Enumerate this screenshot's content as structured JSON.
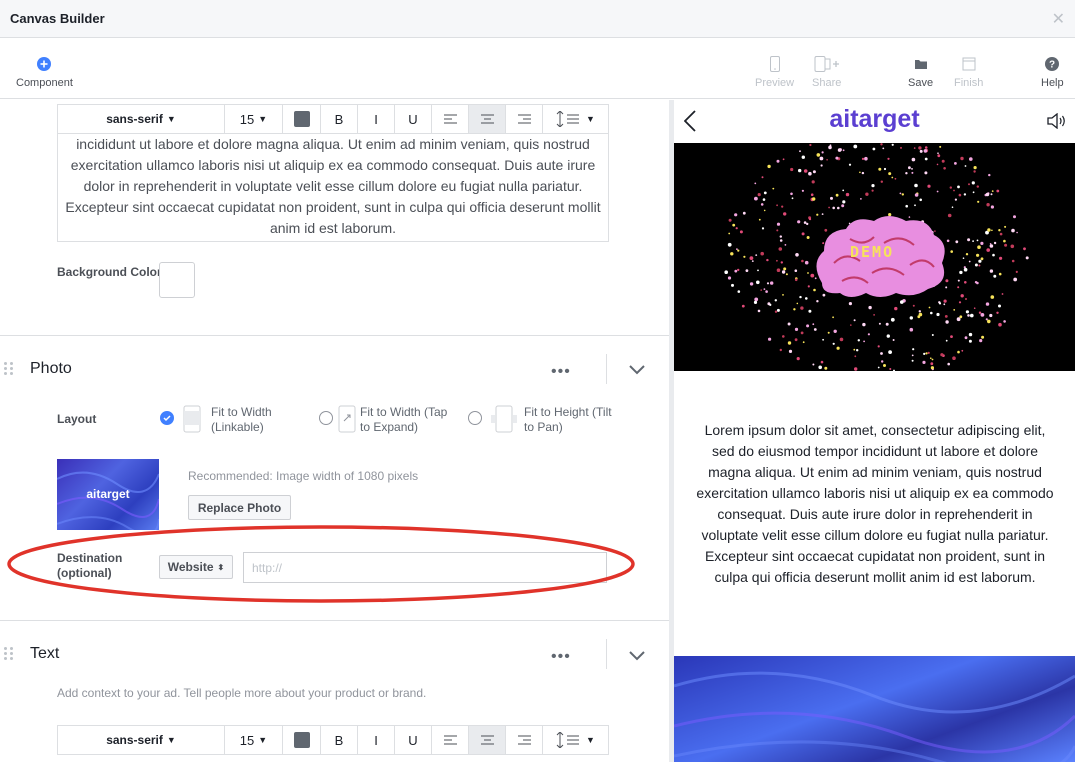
{
  "app": {
    "title": "Canvas Builder"
  },
  "toolbar": {
    "component": "Component",
    "preview": "Preview",
    "share": "Share",
    "save": "Save",
    "finish": "Finish",
    "help": "Help"
  },
  "text_editor_top": {
    "font": "sans-serif",
    "size": "15",
    "bold": "B",
    "italic": "I",
    "underline": "U",
    "body": "incididunt ut labore et dolore magna aliqua. Ut enim ad minim veniam, quis nostrud exercitation ullamco laboris nisi ut aliquip ex ea commodo consequat. Duis aute irure dolor in reprehenderit in voluptate velit esse cillum dolore eu fugiat nulla pariatur. Excepteur sint occaecat cupidatat non proident, sunt in culpa qui officia deserunt mollit anim id est laborum."
  },
  "background_color_label": "Background Color",
  "photo": {
    "title": "Photo",
    "more": "•••",
    "layout_label": "Layout",
    "options": [
      {
        "label": "Fit to Width (Linkable)",
        "selected": true
      },
      {
        "label": "Fit to Width (Tap to Expand)",
        "selected": false
      },
      {
        "label": "Fit to Height (Tilt to Pan)",
        "selected": false
      }
    ],
    "thumb_text": "aitarget",
    "recommended": "Recommended: Image width of 1080 pixels",
    "replace_button": "Replace Photo",
    "destination_label": "Destination (optional)",
    "destination_type": "Website",
    "destination_placeholder": "http://"
  },
  "text_section": {
    "title": "Text",
    "more": "•••",
    "description": "Add context to your ad. Tell people more about your product or brand.",
    "font": "sans-serif",
    "size": "15",
    "bold": "B",
    "italic": "I",
    "underline": "U"
  },
  "preview": {
    "brand": "aitarget",
    "image_text": "DEMO",
    "body": "Lorem ipsum dolor sit amet, consectetur adipiscing elit, sed do eiusmod tempor incididunt ut labore et dolore magna aliqua. Ut enim ad minim veniam, quis nostrud exercitation ullamco laboris nisi ut aliquip ex ea commodo consequat. Duis aute irure dolor in reprehenderit in voluptate velit esse cillum dolore eu fugiat nulla pariatur. Excepteur sint occaecat cupidatat non proident, sunt in culpa qui officia deserunt mollit anim id est laborum."
  },
  "colors": {
    "accent": "#4080ff",
    "highlight_ring": "#e0332a",
    "brand": "#5b3fd1",
    "brain": "#e88ee0"
  }
}
